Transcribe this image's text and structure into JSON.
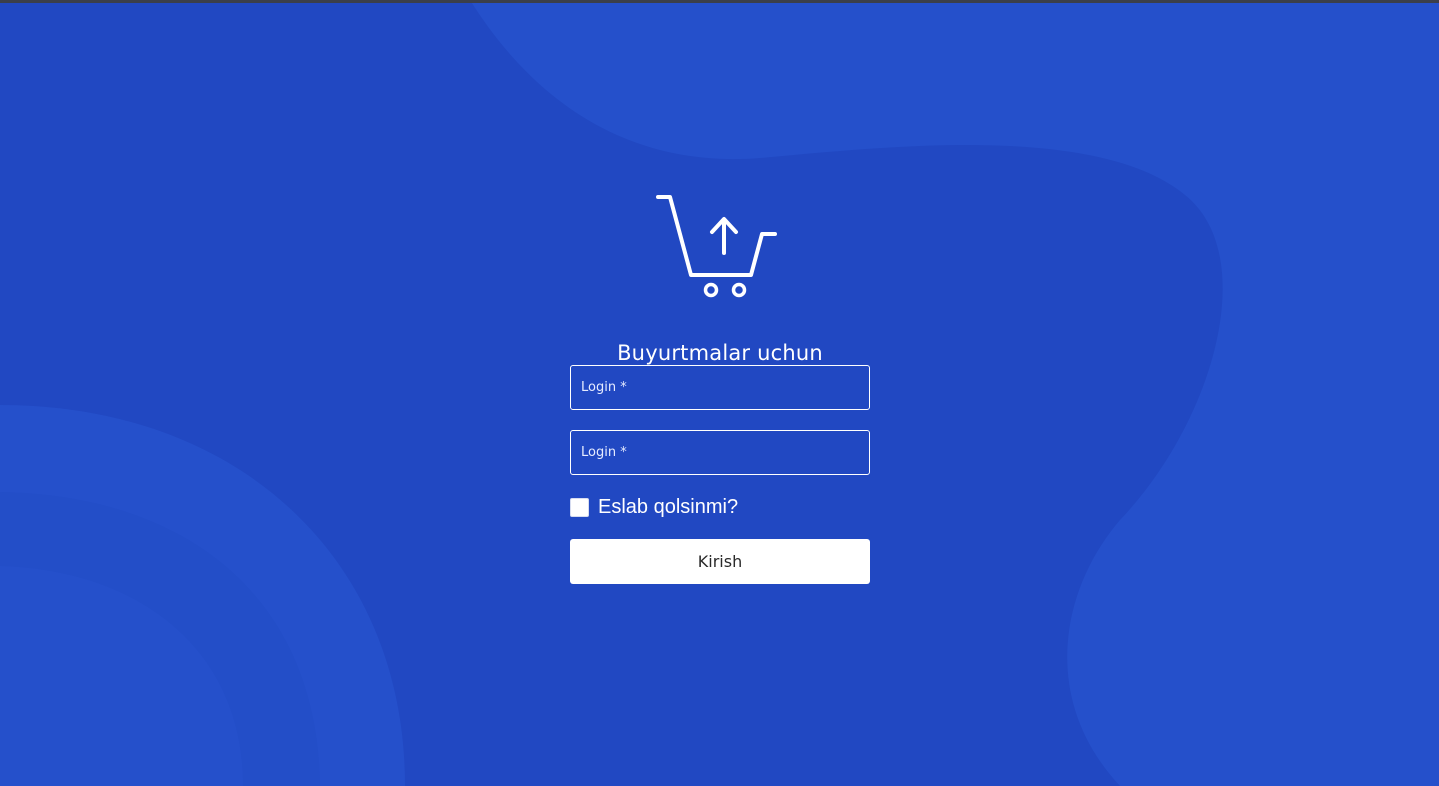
{
  "logo": {
    "icon": "shopping-cart-upload-icon"
  },
  "title": "Buyurtmalar uchun",
  "form": {
    "login_placeholder": "Login *",
    "password_placeholder": "Login *",
    "remember_label": "Eslab qolsinmi?",
    "remember_checked": false,
    "submit_label": "Kirish"
  },
  "colors": {
    "background": "#2148c2",
    "blob": "#2550cb",
    "text": "#ffffff",
    "button_bg": "#ffffff"
  }
}
